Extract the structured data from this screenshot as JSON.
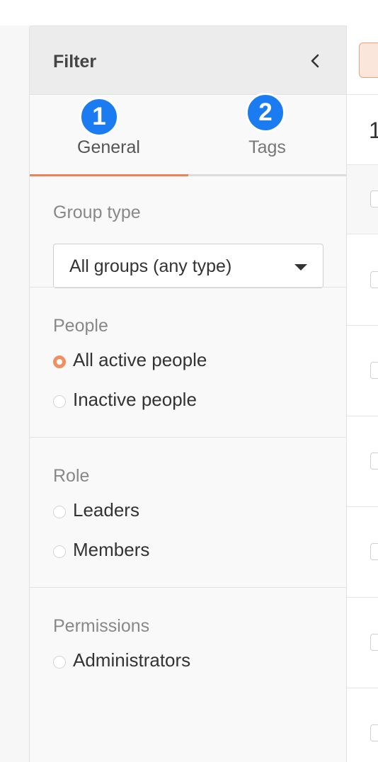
{
  "filter": {
    "title": "Filter",
    "collapse_icon": "chevron-left-icon",
    "tabs": [
      {
        "label": "General",
        "badge": "1"
      },
      {
        "label": "Tags",
        "badge": "2"
      }
    ],
    "accent_color": "#e8835a",
    "badge_color": "#1b7cf1",
    "sections": {
      "group_type": {
        "label": "Group type",
        "selected": "All groups (any type)"
      },
      "people": {
        "label": "People",
        "options": [
          {
            "label": "All active people",
            "checked": true
          },
          {
            "label": "Inactive people",
            "checked": false
          }
        ]
      },
      "role": {
        "label": "Role",
        "options": [
          {
            "label": "Leaders",
            "checked": false
          },
          {
            "label": "Members",
            "checked": false
          }
        ]
      },
      "permissions": {
        "label": "Permissions",
        "options": [
          {
            "label": "Administrators",
            "checked": false
          }
        ]
      }
    }
  },
  "results": {
    "count_partial": "1"
  }
}
